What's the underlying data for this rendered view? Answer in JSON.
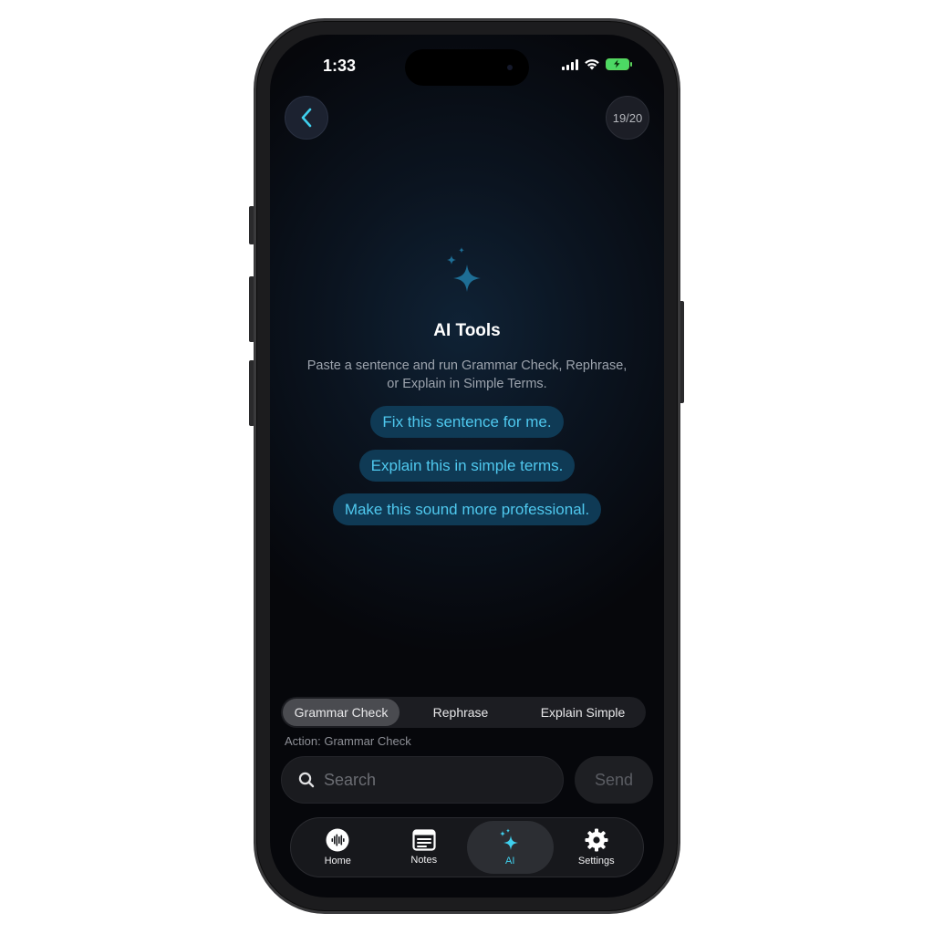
{
  "status_bar": {
    "time": "1:33"
  },
  "header": {
    "counter": "19/20"
  },
  "hero": {
    "title": "AI Tools",
    "subtitle": "Paste a sentence and run Grammar Check, Rephrase, or Explain in Simple Terms."
  },
  "suggestions": [
    "Fix this sentence for me.",
    "Explain this in simple terms.",
    "Make this sound more professional."
  ],
  "modes": {
    "items": [
      "Grammar Check",
      "Rephrase",
      "Explain Simple"
    ],
    "selected": "Grammar Check"
  },
  "action_label": "Action: Grammar Check",
  "input": {
    "placeholder": "Search",
    "value": ""
  },
  "send_label": "Send",
  "tabs": [
    {
      "label": "Home",
      "icon": "waveform-icon"
    },
    {
      "label": "Notes",
      "icon": "notes-icon"
    },
    {
      "label": "AI",
      "icon": "sparkles-icon"
    },
    {
      "label": "Settings",
      "icon": "gear-icon"
    }
  ],
  "colors": {
    "accent": "#3fd0ee",
    "chip_bg": "#0f3a55",
    "battery": "#4cd964"
  }
}
